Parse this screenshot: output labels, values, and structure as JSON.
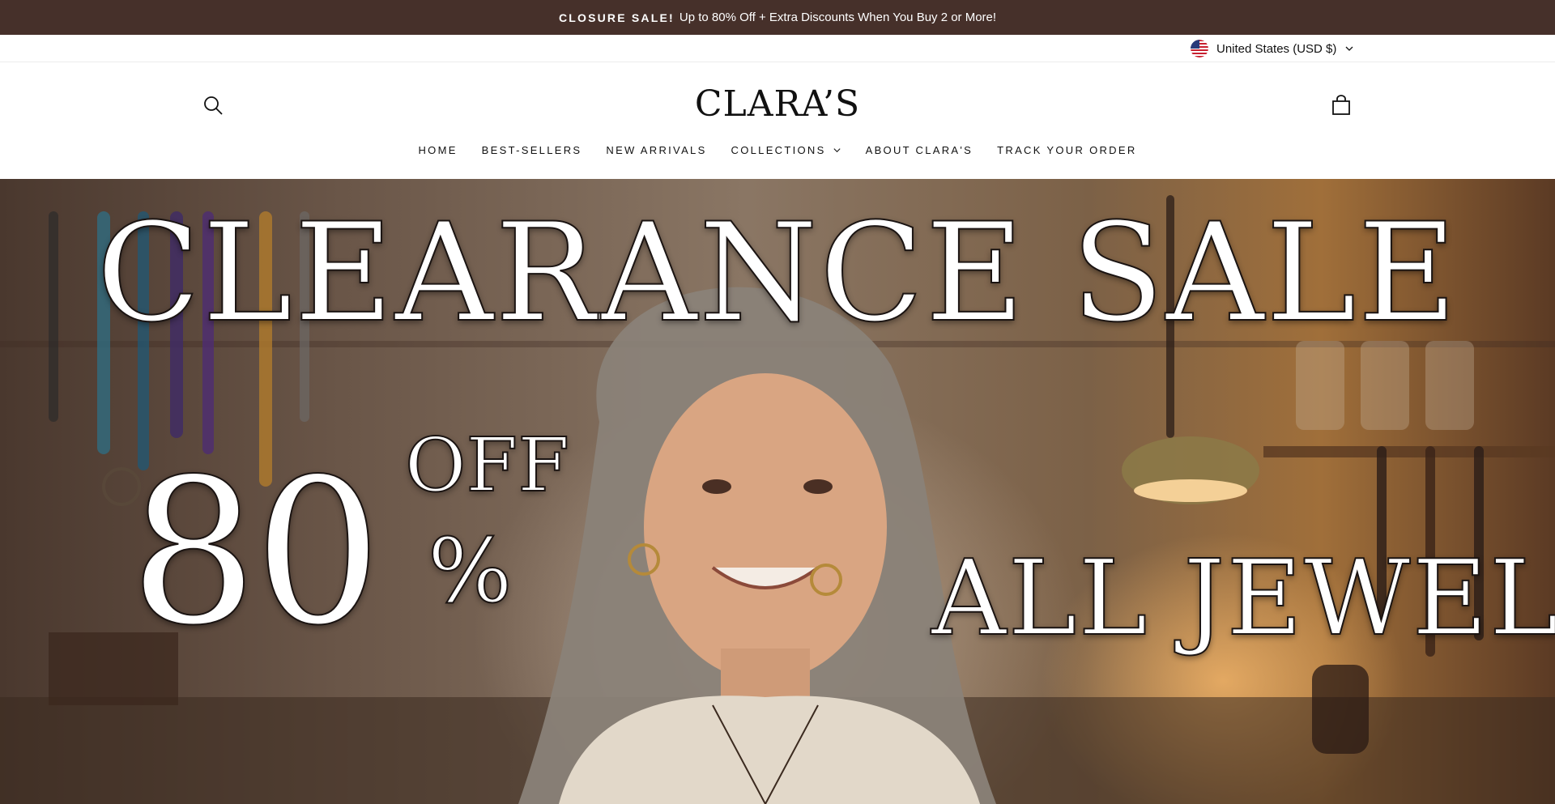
{
  "announcement": {
    "strong": "CLOSURE SALE!",
    "text": "Up to 80% Off + Extra Discounts When You Buy 2 or More!"
  },
  "locale": {
    "label": "United States (USD $)",
    "flag_icon": "us-flag-icon",
    "chevron_icon": "chevron-down-icon"
  },
  "header": {
    "logo": "CLARA’S",
    "search_icon": "search-icon",
    "cart_icon": "shopping-bag-icon"
  },
  "nav": {
    "items": [
      {
        "label": "HOME"
      },
      {
        "label": "BEST-SELLERS"
      },
      {
        "label": "NEW ARRIVALS"
      },
      {
        "label": "COLLECTIONS",
        "has_dropdown": true
      },
      {
        "label": "ABOUT CLARA'S"
      },
      {
        "label": "TRACK YOUR ORDER"
      }
    ]
  },
  "hero": {
    "headline": "CLEARANCE SALE",
    "discount_number": "80",
    "discount_percent": "%",
    "discount_off": "OFF",
    "subline": "ALL JEWELS"
  },
  "colors": {
    "announcement_bg": "#46302a",
    "announcement_text": "#ffffff",
    "text": "#111111",
    "background": "#ffffff"
  }
}
